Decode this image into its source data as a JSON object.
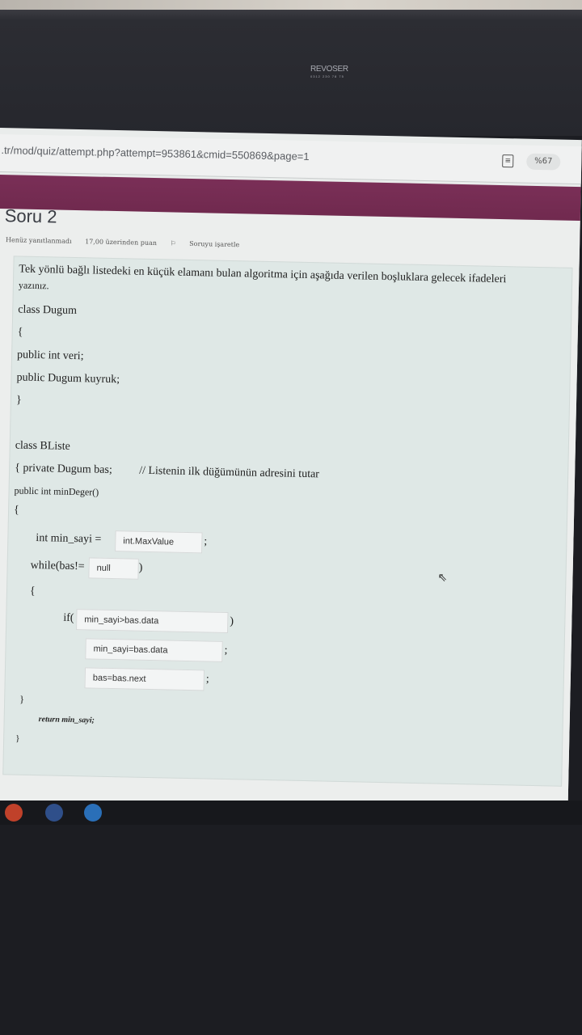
{
  "monitor": {
    "brand": "REVOSER",
    "brand_sub": "0312 230 78 75"
  },
  "browser": {
    "url": ".tr/mod/quiz/attempt.php?attempt=953861&cmid=550869&page=1",
    "zoom": "%67",
    "reader_icon": "reader-view-icon"
  },
  "question": {
    "title": "Soru 2",
    "status": "Henüz yanıtlanmadı",
    "points": "17,00 üzerinden puan",
    "flag_label": "Soruyu işaretle",
    "prompt_line1": "Tek yönlü bağlı listedeki en küçük elamanı bulan algoritma için aşağıda verilen boşluklara gelecek ifadeleri",
    "prompt_line2": "yazınız.",
    "code": {
      "l1": "class Dugum",
      "l2": "{",
      "l3": "public int veri;",
      "l4": "public Dugum kuyruk;",
      "l5": "}",
      "l6": "class BListe",
      "l7a": "{ private Dugum bas;",
      "l7b": "// Listenin ilk düğümünün adresini tutar",
      "l8": "public int minDeger()",
      "l9": "{",
      "l10a": "int min_sayi =",
      "l10b": ";",
      "l11a": "while(bas!=",
      "l11b": ")",
      "l12": "{",
      "l13a": "if(",
      "l13b": ")",
      "l14b": ";",
      "l15b": ";",
      "l16": "}",
      "l17": "return min_sayi;",
      "l18": "}"
    },
    "answers": {
      "a1": "int.MaxValue",
      "a2": "null",
      "a3": "min_sayi>bas.data",
      "a4": "min_sayi=bas.data",
      "a5": "bas=bas.next"
    }
  }
}
